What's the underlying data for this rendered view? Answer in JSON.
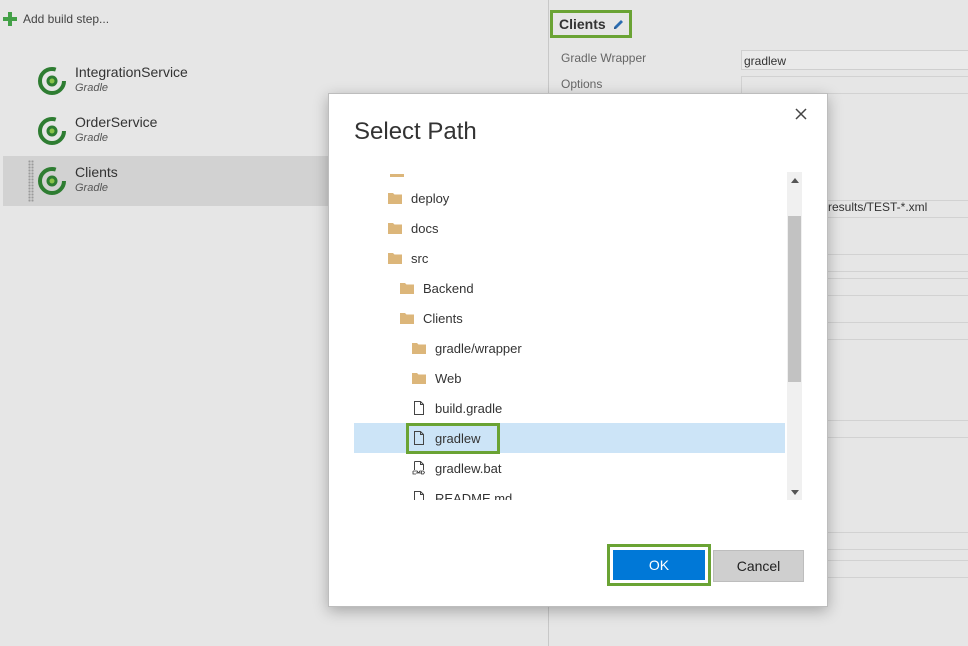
{
  "left": {
    "add_step_label": "Add build step...",
    "steps": [
      {
        "name": "IntegrationService",
        "type": "Gradle"
      },
      {
        "name": "OrderService",
        "type": "Gradle"
      },
      {
        "name": "Clients",
        "type": "Gradle"
      }
    ]
  },
  "right": {
    "title": "Clients",
    "wrapper_label": "Gradle Wrapper",
    "wrapper_value": "gradlew",
    "options_label": "Options",
    "test_results_partial": "-results/TEST-*.xml"
  },
  "dialog": {
    "title": "Select Path",
    "tree": [
      {
        "label": "deploy",
        "type": "folder"
      },
      {
        "label": "docs",
        "type": "folder"
      },
      {
        "label": "src",
        "type": "folder"
      },
      {
        "label": "Backend",
        "type": "folder"
      },
      {
        "label": "Clients",
        "type": "folder"
      },
      {
        "label": "gradle/wrapper",
        "type": "folder"
      },
      {
        "label": "Web",
        "type": "folder"
      },
      {
        "label": "build.gradle",
        "type": "file"
      },
      {
        "label": "gradlew",
        "type": "file"
      },
      {
        "label": "gradlew.bat",
        "type": "cmd-file"
      },
      {
        "label": "README.md",
        "type": "file"
      }
    ],
    "ok_label": "OK",
    "cancel_label": "Cancel"
  },
  "colors": {
    "accent_green": "#6aa334",
    "primary_blue": "#0078d7",
    "selection_blue": "#cce4f7",
    "folder": "#dcb67a"
  }
}
